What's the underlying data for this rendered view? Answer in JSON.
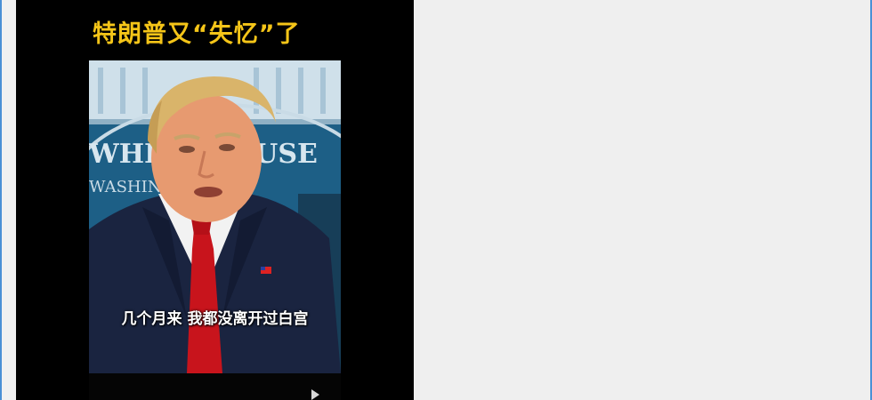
{
  "video": {
    "title": "特朗普又“失忆”了",
    "subtitle": "几个月来 我都没离开过白宫",
    "backdrop_sign": {
      "line1": "WHITE HOUSE",
      "line2": "WASHINGTON"
    }
  },
  "colors": {
    "title": "#f5c518",
    "subtitle": "#ffffff",
    "frame_accent": "#4a90d6",
    "backdrop": "#1d5f86",
    "panel": "#000000",
    "page_bg": "#efefef"
  },
  "icons": {
    "play": "play-icon"
  }
}
